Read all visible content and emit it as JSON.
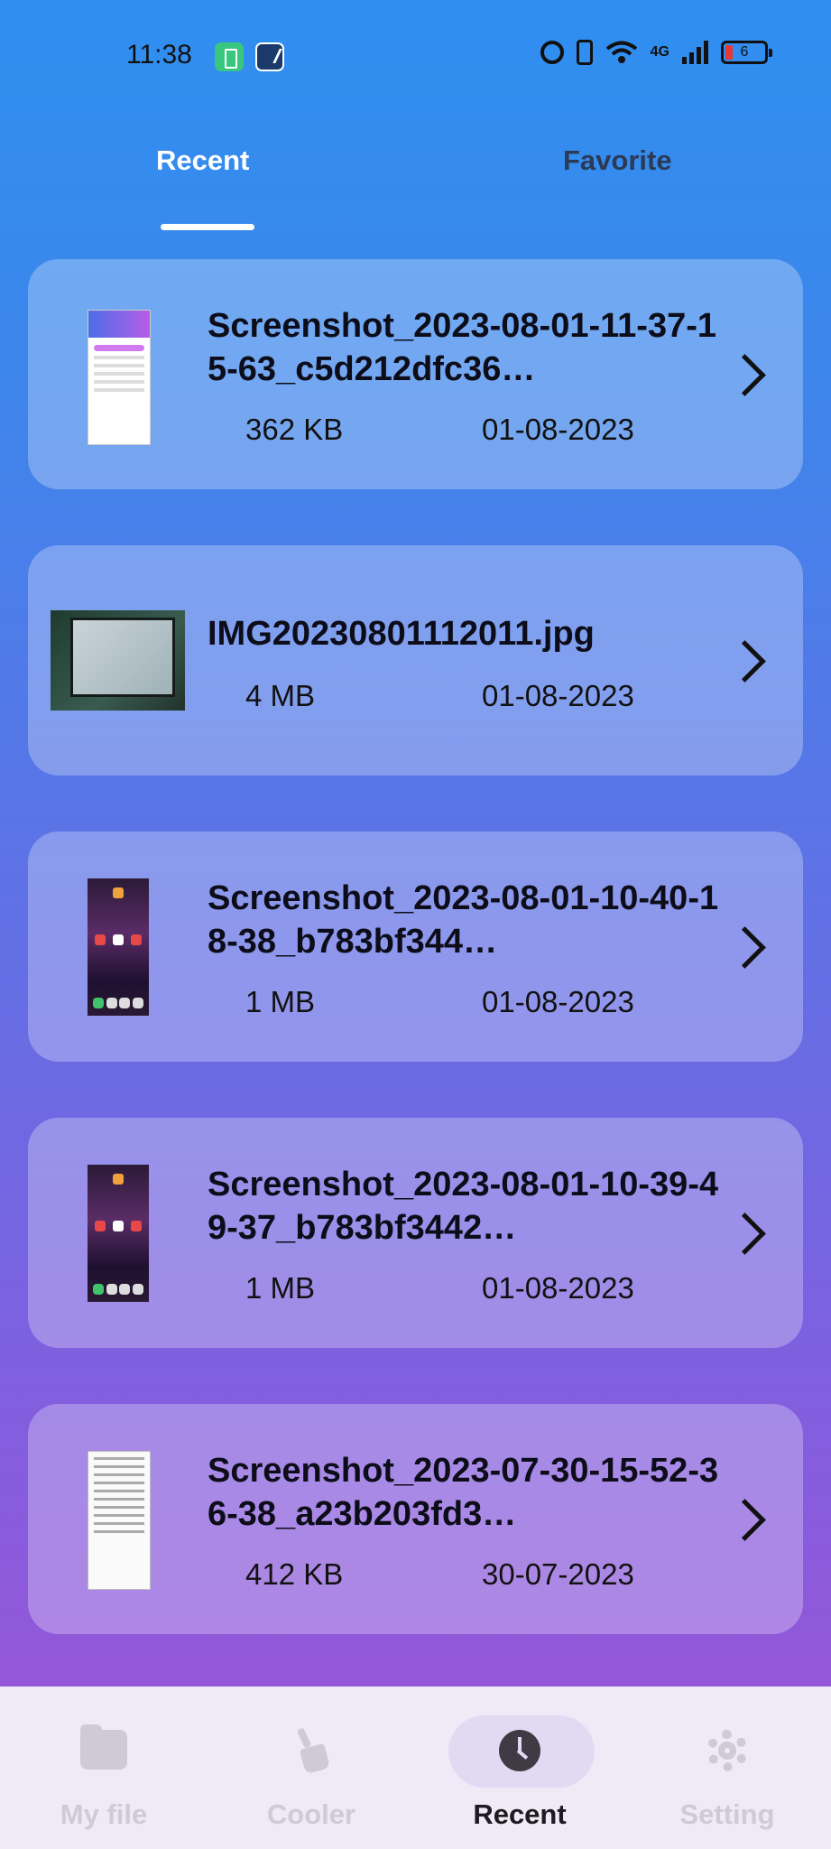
{
  "status_bar": {
    "time": "11:38",
    "network": "4G",
    "battery": "6"
  },
  "tabs": {
    "recent": "Recent",
    "favorite": "Favorite"
  },
  "files": [
    {
      "name": "Screenshot_2023-08-01-11-37-15-63_c5d212dfc36…",
      "size": "362 KB",
      "date": "01-08-2023",
      "thumb": "screenshot-app"
    },
    {
      "name": "IMG20230801112011.jpg",
      "size": "4 MB",
      "date": "01-08-2023",
      "thumb": "photo"
    },
    {
      "name": "Screenshot_2023-08-01-10-40-18-38_b783bf344…",
      "size": "1 MB",
      "date": "01-08-2023",
      "thumb": "homescreen"
    },
    {
      "name": "Screenshot_2023-08-01-10-39-49-37_b783bf3442…",
      "size": "1 MB",
      "date": "01-08-2023",
      "thumb": "homescreen"
    },
    {
      "name": "Screenshot_2023-07-30-15-52-36-38_a23b203fd3…",
      "size": "412 KB",
      "date": "30-07-2023",
      "thumb": "document"
    }
  ],
  "bottom_nav": [
    {
      "label": "My file",
      "icon": "folder-icon",
      "active": false
    },
    {
      "label": "Cooler",
      "icon": "broom-icon",
      "active": false
    },
    {
      "label": "Recent",
      "icon": "clock-icon",
      "active": true
    },
    {
      "label": "Setting",
      "icon": "gear-icon",
      "active": false
    }
  ],
  "colors": {
    "gradient_top": "#2f8ff0",
    "gradient_bottom": "#9a55d8",
    "nav_bg": "#efeaf6",
    "active_pill": "#e0dbf3"
  }
}
